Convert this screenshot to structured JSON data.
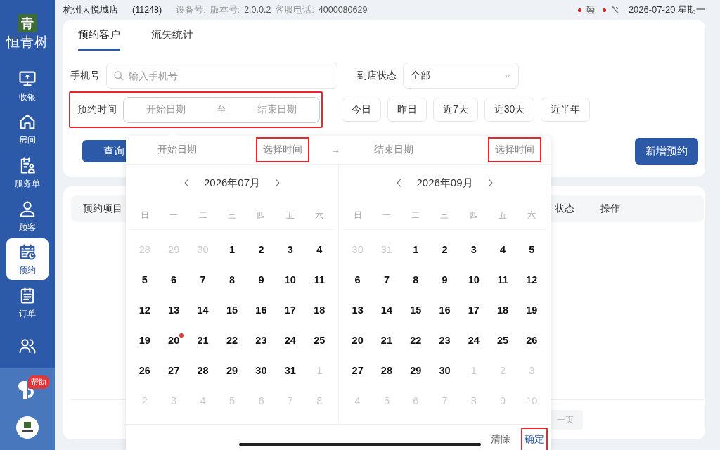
{
  "sidebar": {
    "logo_mark": "青",
    "logo_text": "恒青树",
    "items": [
      {
        "label": "收银",
        "selected": false
      },
      {
        "label": "房间",
        "selected": false
      },
      {
        "label": "服务单",
        "selected": false
      },
      {
        "label": "顾客",
        "selected": false
      },
      {
        "label": "预约",
        "selected": true
      },
      {
        "label": "订单",
        "selected": false
      },
      {
        "selected": false
      }
    ],
    "help_badge": "帮助"
  },
  "top_bar": {
    "store": "杭州大悦城店",
    "store_code": "(11248)",
    "device_label": "设备号:",
    "version_label": "版本号:",
    "version": "2.0.0.2",
    "phone_label": "客服电话:",
    "phone": "4000080629",
    "status_icons": [
      {
        "alert": true
      },
      {
        "alert": true
      }
    ],
    "date": "2026-07-20 星期一"
  },
  "tabs": [
    {
      "label": "预约客户",
      "selected": true
    },
    {
      "label": "流失统计",
      "selected": false
    }
  ],
  "filters": {
    "phone_label": "手机号",
    "phone_placeholder": "输入手机号",
    "status_label": "到店状态",
    "status_value": "全部",
    "time_label": "预约时间",
    "time_highlighted": true,
    "start_placeholder": "开始日期",
    "range_sep": "至",
    "end_placeholder": "结束日期",
    "quick_ranges": [
      "今日",
      "昨日",
      "近7天",
      "近30天",
      "近半年"
    ]
  },
  "buttons": {
    "query": "查询",
    "add": "新增预约"
  },
  "table": {
    "columns": [
      "预约项目",
      "状态",
      "操作"
    ]
  },
  "pagination": {
    "next": "一页"
  },
  "picker": {
    "start_label": "开始日期",
    "start_time": {
      "text": "选择时间",
      "highlighted": true
    },
    "arrow": "→",
    "end_label": "结束日期",
    "end_time": {
      "text": "选择时间",
      "highlighted": true
    },
    "months": [
      {
        "title": "2026年07月",
        "weekdays": [
          "日",
          "一",
          "二",
          "三",
          "四",
          "五",
          "六"
        ],
        "days": [
          {
            "d": "28",
            "kind": "other"
          },
          {
            "d": "29",
            "kind": "other"
          },
          {
            "d": "30",
            "kind": "other"
          },
          {
            "d": "1",
            "kind": "cur"
          },
          {
            "d": "2",
            "kind": "cur"
          },
          {
            "d": "3",
            "kind": "cur"
          },
          {
            "d": "4",
            "kind": "cur"
          },
          {
            "d": "5",
            "kind": "cur"
          },
          {
            "d": "6",
            "kind": "cur"
          },
          {
            "d": "7",
            "kind": "cur"
          },
          {
            "d": "8",
            "kind": "cur"
          },
          {
            "d": "9",
            "kind": "cur"
          },
          {
            "d": "10",
            "kind": "cur"
          },
          {
            "d": "11",
            "kind": "cur"
          },
          {
            "d": "12",
            "kind": "cur"
          },
          {
            "d": "13",
            "kind": "cur"
          },
          {
            "d": "14",
            "kind": "cur"
          },
          {
            "d": "15",
            "kind": "cur"
          },
          {
            "d": "16",
            "kind": "cur"
          },
          {
            "d": "17",
            "kind": "cur"
          },
          {
            "d": "18",
            "kind": "cur"
          },
          {
            "d": "19",
            "kind": "cur"
          },
          {
            "d": "20",
            "kind": "today"
          },
          {
            "d": "21",
            "kind": "cur"
          },
          {
            "d": "22",
            "kind": "cur"
          },
          {
            "d": "23",
            "kind": "cur"
          },
          {
            "d": "24",
            "kind": "cur"
          },
          {
            "d": "25",
            "kind": "cur"
          },
          {
            "d": "26",
            "kind": "cur"
          },
          {
            "d": "27",
            "kind": "cur"
          },
          {
            "d": "28",
            "kind": "cur"
          },
          {
            "d": "29",
            "kind": "cur"
          },
          {
            "d": "30",
            "kind": "cur"
          },
          {
            "d": "31",
            "kind": "cur"
          },
          {
            "d": "1",
            "kind": "other"
          },
          {
            "d": "2",
            "kind": "other"
          },
          {
            "d": "3",
            "kind": "other"
          },
          {
            "d": "4",
            "kind": "other"
          },
          {
            "d": "5",
            "kind": "other"
          },
          {
            "d": "6",
            "kind": "other"
          },
          {
            "d": "7",
            "kind": "other"
          },
          {
            "d": "8",
            "kind": "other"
          }
        ]
      },
      {
        "title": "2026年09月",
        "weekdays": [
          "日",
          "一",
          "二",
          "三",
          "四",
          "五",
          "六"
        ],
        "days": [
          {
            "d": "30",
            "kind": "other"
          },
          {
            "d": "31",
            "kind": "other"
          },
          {
            "d": "1",
            "kind": "cur"
          },
          {
            "d": "2",
            "kind": "cur"
          },
          {
            "d": "3",
            "kind": "cur"
          },
          {
            "d": "4",
            "kind": "cur"
          },
          {
            "d": "5",
            "kind": "cur"
          },
          {
            "d": "6",
            "kind": "cur"
          },
          {
            "d": "7",
            "kind": "cur"
          },
          {
            "d": "8",
            "kind": "cur"
          },
          {
            "d": "9",
            "kind": "cur"
          },
          {
            "d": "10",
            "kind": "cur"
          },
          {
            "d": "11",
            "kind": "cur"
          },
          {
            "d": "12",
            "kind": "cur"
          },
          {
            "d": "13",
            "kind": "cur"
          },
          {
            "d": "14",
            "kind": "cur"
          },
          {
            "d": "15",
            "kind": "cur"
          },
          {
            "d": "16",
            "kind": "cur"
          },
          {
            "d": "17",
            "kind": "cur"
          },
          {
            "d": "18",
            "kind": "cur"
          },
          {
            "d": "19",
            "kind": "cur"
          },
          {
            "d": "20",
            "kind": "cur"
          },
          {
            "d": "21",
            "kind": "cur"
          },
          {
            "d": "22",
            "kind": "cur"
          },
          {
            "d": "23",
            "kind": "cur"
          },
          {
            "d": "24",
            "kind": "cur"
          },
          {
            "d": "25",
            "kind": "cur"
          },
          {
            "d": "26",
            "kind": "cur"
          },
          {
            "d": "27",
            "kind": "cur"
          },
          {
            "d": "28",
            "kind": "cur"
          },
          {
            "d": "29",
            "kind": "cur"
          },
          {
            "d": "30",
            "kind": "cur"
          },
          {
            "d": "1",
            "kind": "other"
          },
          {
            "d": "2",
            "kind": "other"
          },
          {
            "d": "3",
            "kind": "other"
          },
          {
            "d": "4",
            "kind": "other"
          },
          {
            "d": "5",
            "kind": "other"
          },
          {
            "d": "6",
            "kind": "other"
          },
          {
            "d": "7",
            "kind": "other"
          },
          {
            "d": "8",
            "kind": "other"
          },
          {
            "d": "9",
            "kind": "other"
          },
          {
            "d": "10",
            "kind": "other"
          }
        ]
      }
    ],
    "clear": "清除",
    "confirm": {
      "text": "确定",
      "highlighted": true
    }
  }
}
